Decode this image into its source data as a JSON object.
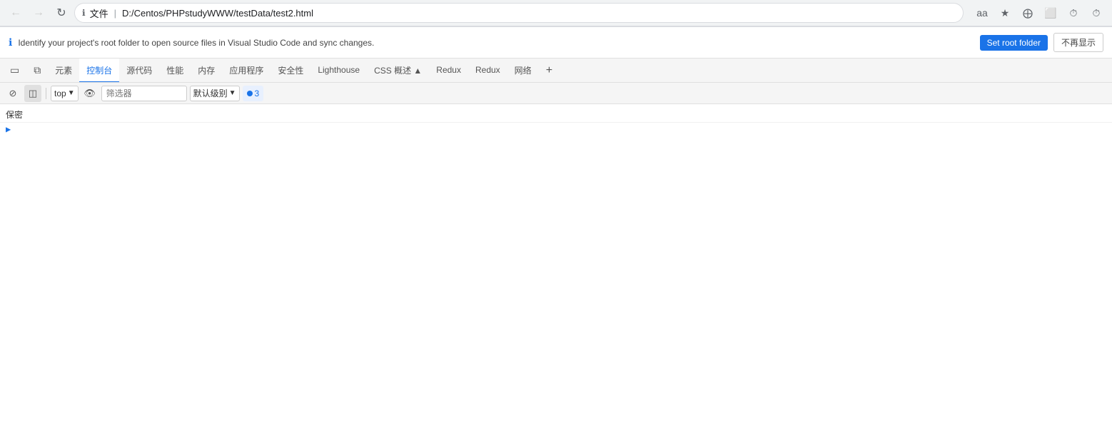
{
  "browser": {
    "back_disabled": true,
    "forward_disabled": true,
    "reload_title": "重新加载",
    "address_icon": "ℹ",
    "address_file_label": "文件",
    "address_sep": "|",
    "address_url": "D:/Centos/PHPstudyWWW/testData/test2.html",
    "actions": [
      "aa",
      "★",
      "⊕",
      "⬜",
      "⏱",
      "⏱"
    ]
  },
  "info_banner": {
    "icon": "ℹ",
    "text": "Identify your project's root folder to open source files in Visual Studio Code and sync changes.",
    "set_root_label": "Set root folder",
    "dismiss_label": "不再显示"
  },
  "tabs": [
    {
      "id": "inspect",
      "label": "",
      "icon": "⬛",
      "type": "icon-only",
      "active": false
    },
    {
      "id": "device",
      "label": "",
      "icon": "⧉",
      "type": "icon-only",
      "active": false
    },
    {
      "id": "elements",
      "label": "元素",
      "active": false
    },
    {
      "id": "console",
      "label": "控制台",
      "active": true
    },
    {
      "id": "sources",
      "label": "源代码",
      "active": false
    },
    {
      "id": "performance",
      "label": "性能",
      "active": false
    },
    {
      "id": "memory",
      "label": "内存",
      "active": false
    },
    {
      "id": "application",
      "label": "应用程序",
      "active": false
    },
    {
      "id": "security",
      "label": "安全性",
      "active": false
    },
    {
      "id": "lighthouse",
      "label": "Lighthouse",
      "active": false
    },
    {
      "id": "css-overview",
      "label": "CSS 概述",
      "active": false
    },
    {
      "id": "redux1",
      "label": "Redux",
      "active": false
    },
    {
      "id": "redux2",
      "label": "Redux",
      "active": false
    },
    {
      "id": "network",
      "label": "网络",
      "active": false
    }
  ],
  "console_toolbar": {
    "clear_icon": "🚫",
    "show_drawer_icon": "⊟",
    "top_label": "top",
    "eye_icon": "👁",
    "filter_placeholder": "筛选器",
    "level_label": "默认级别",
    "issues_count": "3",
    "issues_label": "3"
  },
  "console_output": {
    "group_label": "保密",
    "expand_arrow": "▶"
  }
}
